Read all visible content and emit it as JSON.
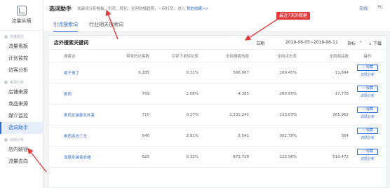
{
  "sidebar": {
    "logo_text": "流量纵横",
    "sections": [
      {
        "label": "流量概况",
        "items": [
          "流量看板",
          "计划监控",
          "访客分析"
        ]
      },
      {
        "label": "来源分析",
        "items": [
          "店铺来源",
          "商品来源",
          "媒介监控",
          "选词助手"
        ]
      },
      {
        "label": "动线分析",
        "items": [
          "店内路径",
          "流量去向"
        ]
      }
    ],
    "active_item": "选词助手"
  },
  "topbar": {
    "title": "选词助手",
    "description": "关键词分析看板，引流、转化、全网热搜趋势，一网打尽，进入",
    "link": "我的收藏>>",
    "right_items": [
      "无线",
      "PC"
    ]
  },
  "tabs": [
    "引流搜索词",
    "行业相关搜索词"
  ],
  "active_tab": "引流搜索词",
  "callout": "最近7天的数据",
  "panel": {
    "title": "店外搜索关键词",
    "date_label": "日期",
    "date_range": "2019-06-05~2019-06-11",
    "metric_label": "指标",
    "download_label": "下载",
    "columns": [
      "搜索词",
      "带来的访客数",
      "引导下单转化率",
      "全网搜索热度",
      "全网点击率",
      "全网商品数",
      "操作"
    ],
    "rows": [
      {
        "keyword": "裤子男了",
        "visitors": "6,185",
        "cvr": "0.31%",
        "heat": "566,067",
        "ctr": "260.45%",
        "items": "11,694"
      },
      {
        "keyword": "裹西",
        "visitors": "769",
        "cvr": "2.08%",
        "heat": "4,385",
        "ctr": "260.05%",
        "items": "17,778"
      },
      {
        "keyword": "裹西女装款长外套",
        "visitors": "710",
        "cvr": "0.27%",
        "heat": "2,331,241",
        "ctr": "123.03%",
        "items": "265,962"
      },
      {
        "keyword": "裹西连衣三无",
        "visitors": "640",
        "cvr": "3.91%",
        "heat": "3,541",
        "ctr": "302.78%",
        "items": "354"
      },
      {
        "keyword": "加厚女装连衣裙",
        "visitors": "625",
        "cvr": "0.32%",
        "heat": "873,729",
        "ctr": "123.96%",
        "items": "510,472"
      }
    ],
    "favorite_label": "收藏",
    "detail_label": "详情分析"
  },
  "colors": {
    "accent": "#2f6bd8",
    "annotation": "#e33b3b"
  }
}
